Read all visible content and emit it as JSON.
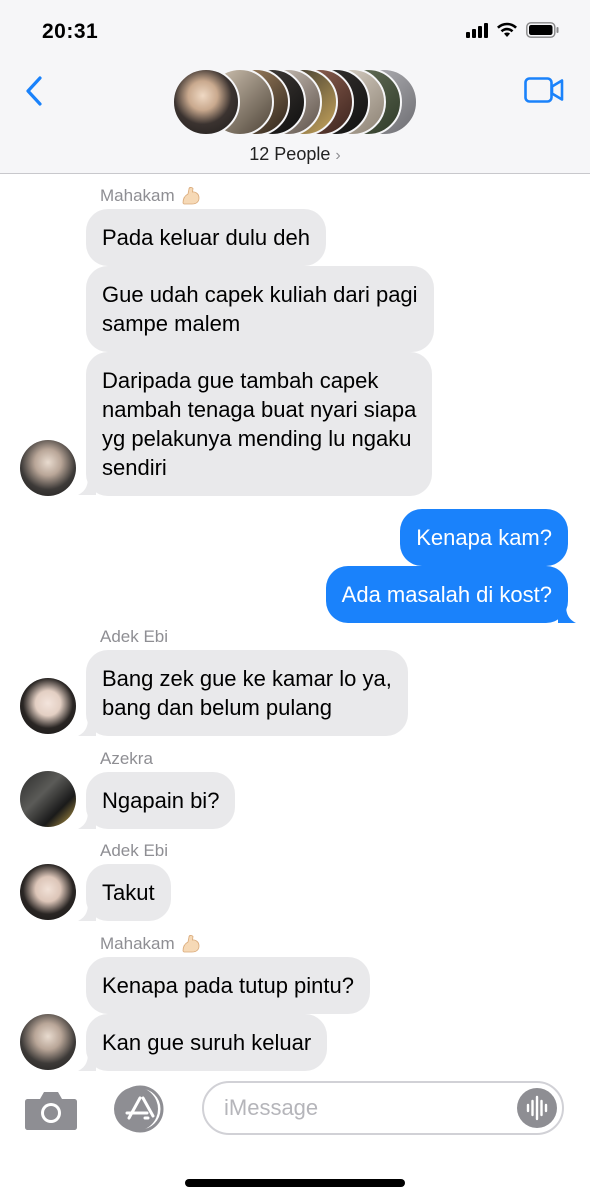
{
  "status_bar": {
    "time": "20:31"
  },
  "header": {
    "people_label": "12 People",
    "back_icon": "chevron-left-icon",
    "video_icon": "video-camera-icon",
    "accent_color": "#1a82fb"
  },
  "messages": [
    {
      "sender": "Mahakam",
      "sender_emoji": "flexed-biceps-icon",
      "direction": "incoming",
      "text": "Pada keluar dulu deh"
    },
    {
      "direction": "incoming",
      "text": "Gue udah capek kuliah dari pagi\nsampe malem"
    },
    {
      "direction": "incoming",
      "text": "Daripada gue tambah capek\nnambah tenaga buat nyari siapa\nyg pelakunya mending lu ngaku\nsendiri"
    },
    {
      "direction": "outgoing",
      "text": "Kenapa kam?"
    },
    {
      "direction": "outgoing",
      "text": "Ada masalah di kost?"
    },
    {
      "sender": "Adek Ebi",
      "direction": "incoming",
      "text": "Bang zek gue ke kamar lo ya,\nbang dan belum pulang"
    },
    {
      "sender": "Azekra",
      "direction": "incoming",
      "text": "Ngapain bi?"
    },
    {
      "sender": "Adek Ebi",
      "direction": "incoming",
      "text": "Takut"
    },
    {
      "sender": "Mahakam",
      "sender_emoji": "flexed-biceps-icon",
      "direction": "incoming",
      "text": "Kenapa pada tutup pintu?"
    },
    {
      "direction": "incoming",
      "text": "Kan gue suruh keluar"
    }
  ],
  "input_bar": {
    "placeholder": "iMessage",
    "camera_icon": "camera-icon",
    "apps_icon": "app-store-icon",
    "audio_icon": "audio-waveform-icon"
  },
  "colors": {
    "incoming_bubble": "#e9e9eb",
    "outgoing_bubble": "#1a82fb",
    "sender_label": "#8e8e93"
  }
}
